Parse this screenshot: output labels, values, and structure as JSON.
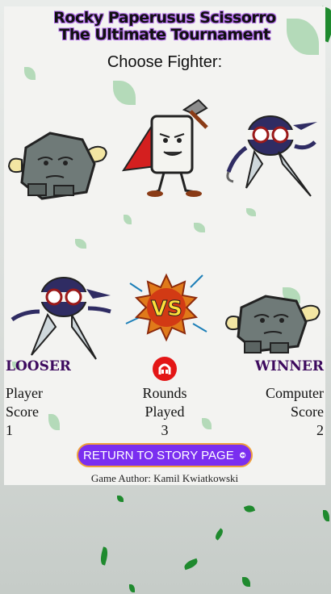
{
  "header": {
    "title_line1": "Rocky Paperusus Scissorro",
    "title_line2": "The Ultimate Tournament",
    "choose_label": "Choose Fighter:"
  },
  "fighters": [
    {
      "name": "rock",
      "icon": "rock-fighter-icon"
    },
    {
      "name": "paper",
      "icon": "paper-fighter-icon"
    },
    {
      "name": "scissors",
      "icon": "scissors-ninja-icon"
    }
  ],
  "battle": {
    "player_pick": "scissors",
    "computer_pick": "rock",
    "vs_icon": "vs-burst-icon"
  },
  "scoreboard": {
    "player_result": "LOOSER",
    "computer_result": "WINNER",
    "player_score_line1": "Player",
    "player_score_line2": "Score",
    "player_score": "1",
    "rounds_line1": "Rounds",
    "rounds_line2": "Played",
    "rounds_played": "3",
    "computer_score_line1": "Computer",
    "computer_score_line2": "Score",
    "computer_score": "2",
    "center_icon": "red-mascot-icon"
  },
  "footer": {
    "return_label": "RETURN TO STORY PAGE",
    "return_icon": "rewind-icon",
    "author": "Game Author: Kamil Kwiatkowski"
  },
  "colors": {
    "title_outline": "#b06be8",
    "result_text": "#3d0a5e",
    "button_bg": "#7a2ef0",
    "button_border": "#f0a03a",
    "icon_red": "#e31616",
    "leaf_green": "#1f8a2e"
  }
}
